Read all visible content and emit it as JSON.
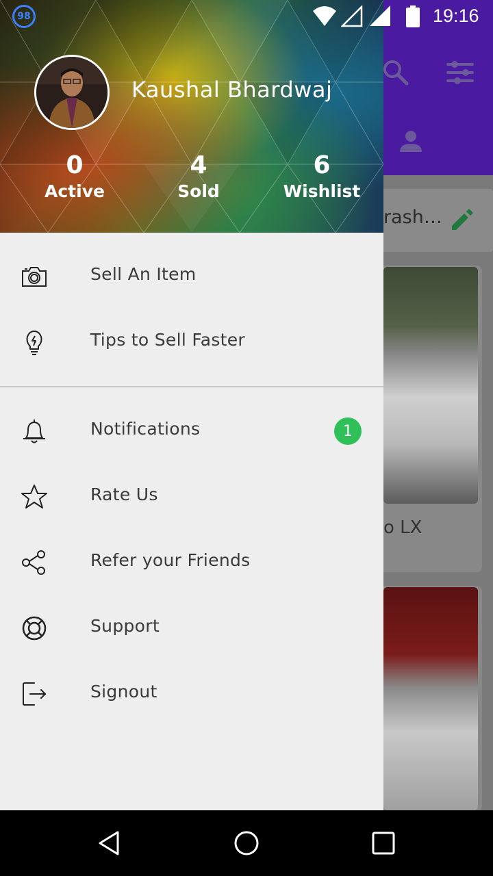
{
  "status_bar": {
    "badge": "98",
    "time": "19:16"
  },
  "background_app": {
    "card_top_text": "rash…",
    "card1_text": "o LX",
    "toolbar_color": "#4a1aa0"
  },
  "drawer": {
    "user": {
      "name": "Kaushal Bhardwaj"
    },
    "stats": [
      {
        "value": "0",
        "label": "Active"
      },
      {
        "value": "4",
        "label": "Sold"
      },
      {
        "value": "6",
        "label": "Wishlist"
      }
    ],
    "menu_primary": [
      {
        "label": "Sell An Item",
        "icon": "camera-icon"
      },
      {
        "label": "Tips to Sell Faster",
        "icon": "lightbulb-icon"
      }
    ],
    "menu_secondary": [
      {
        "label": "Notifications",
        "icon": "bell-icon",
        "badge": "1"
      },
      {
        "label": "Rate Us",
        "icon": "star-icon"
      },
      {
        "label": "Refer your Friends",
        "icon": "share-icon"
      },
      {
        "label": "Support",
        "icon": "lifebuoy-icon"
      },
      {
        "label": "Signout",
        "icon": "signout-icon"
      }
    ],
    "badge_color": "#2fc05a"
  },
  "nav_bar": {
    "buttons": [
      "back-icon",
      "home-icon",
      "recents-icon"
    ]
  }
}
